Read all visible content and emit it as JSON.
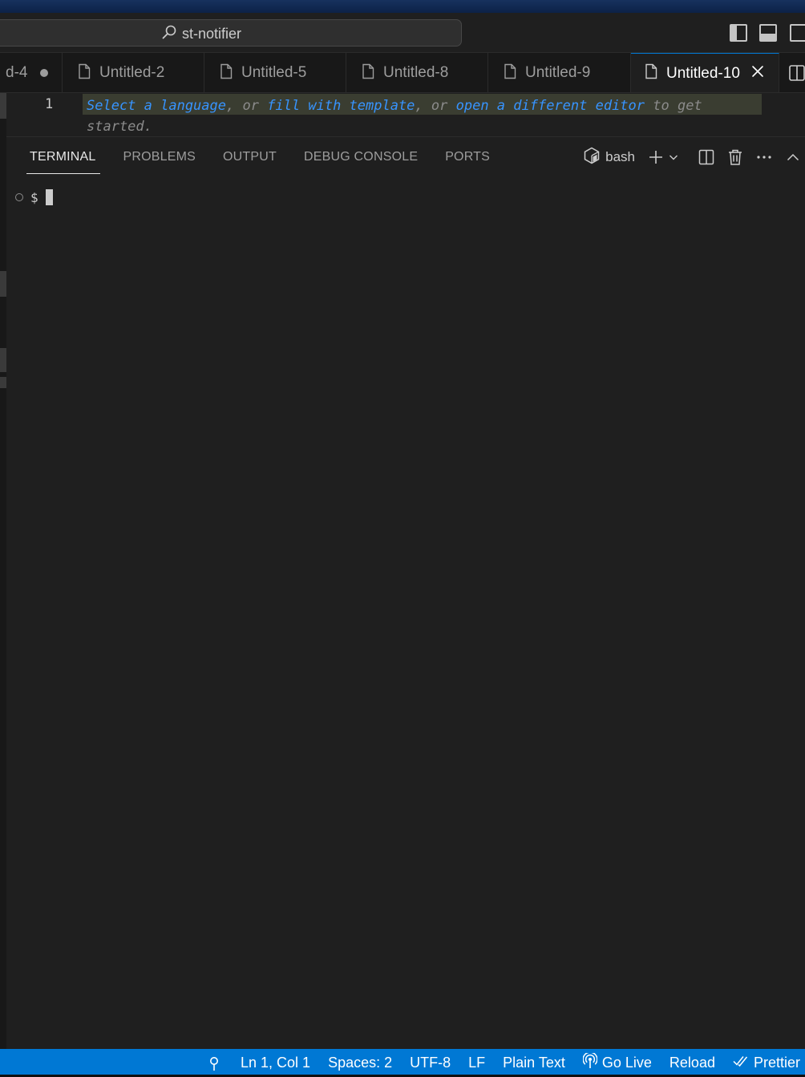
{
  "titlebar": {
    "search_label": "st-notifier"
  },
  "tabs": [
    {
      "label": "d-4",
      "dirty": true
    },
    {
      "label": "Untitled-2"
    },
    {
      "label": "Untitled-5"
    },
    {
      "label": "Untitled-8"
    },
    {
      "label": "Untitled-9"
    },
    {
      "label": "Untitled-10",
      "active": true
    }
  ],
  "editor": {
    "line_number": "1",
    "hint": {
      "select_language": "Select a language",
      "or1": ", or ",
      "fill_template": "fill with template",
      "or2": ", or ",
      "open_editor": "open a different editor",
      "rest": " to get started."
    }
  },
  "panel": {
    "tabs": [
      "TERMINAL",
      "PROBLEMS",
      "OUTPUT",
      "DEBUG CONSOLE",
      "PORTS"
    ],
    "active_tab": "TERMINAL",
    "shell": "bash",
    "prompt": "$"
  },
  "statusbar": {
    "cursor_position": "Ln 1, Col 1",
    "indentation": "Spaces: 2",
    "encoding": "UTF-8",
    "eol": "LF",
    "language": "Plain Text",
    "go_live": "Go Live",
    "reload": "Reload",
    "prettier": "Prettier"
  },
  "colors": {
    "accent": "#0078d4",
    "editor_bg": "#1f1f1f",
    "link": "#3794ff"
  }
}
